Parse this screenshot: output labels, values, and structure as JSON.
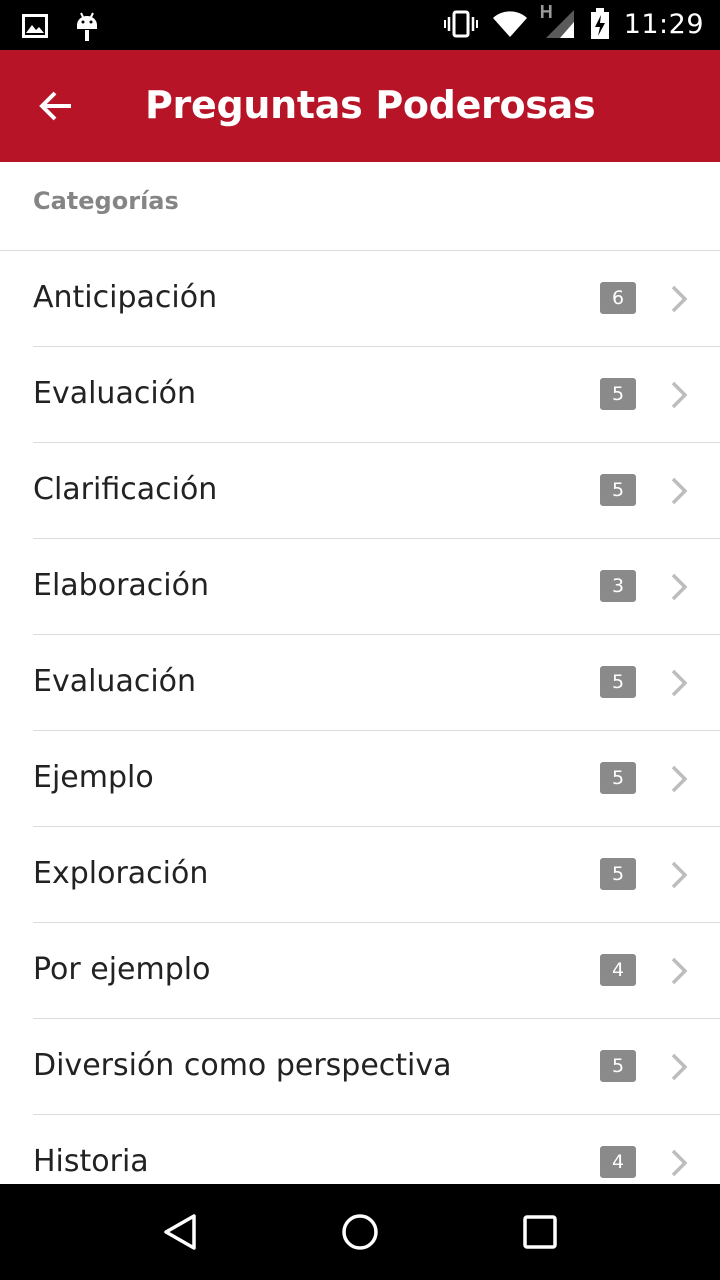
{
  "status_bar": {
    "time": "11:29",
    "network_label": "H",
    "icons": [
      "image-icon",
      "android-icon",
      "vibrate-icon",
      "wifi-icon",
      "signal-icon",
      "battery-charging-icon"
    ]
  },
  "app_bar": {
    "title": "Preguntas Poderosas",
    "back_icon": "arrow-back-icon",
    "color": "#b71427"
  },
  "section": {
    "header": "Categorías"
  },
  "categories": [
    {
      "label": "Anticipación",
      "count": "6"
    },
    {
      "label": "Evaluación",
      "count": "5"
    },
    {
      "label": "Clarificación",
      "count": "5"
    },
    {
      "label": "Elaboración",
      "count": "3"
    },
    {
      "label": "Evaluación",
      "count": "5"
    },
    {
      "label": "Ejemplo",
      "count": "5"
    },
    {
      "label": "Exploración",
      "count": "5"
    },
    {
      "label": "Por ejemplo",
      "count": "4"
    },
    {
      "label": "Diversión como perspectiva",
      "count": "5"
    },
    {
      "label": "Historia",
      "count": "4"
    }
  ],
  "nav_bar": {
    "buttons": [
      "back-triangle-icon",
      "home-circle-icon",
      "recents-square-icon"
    ]
  }
}
